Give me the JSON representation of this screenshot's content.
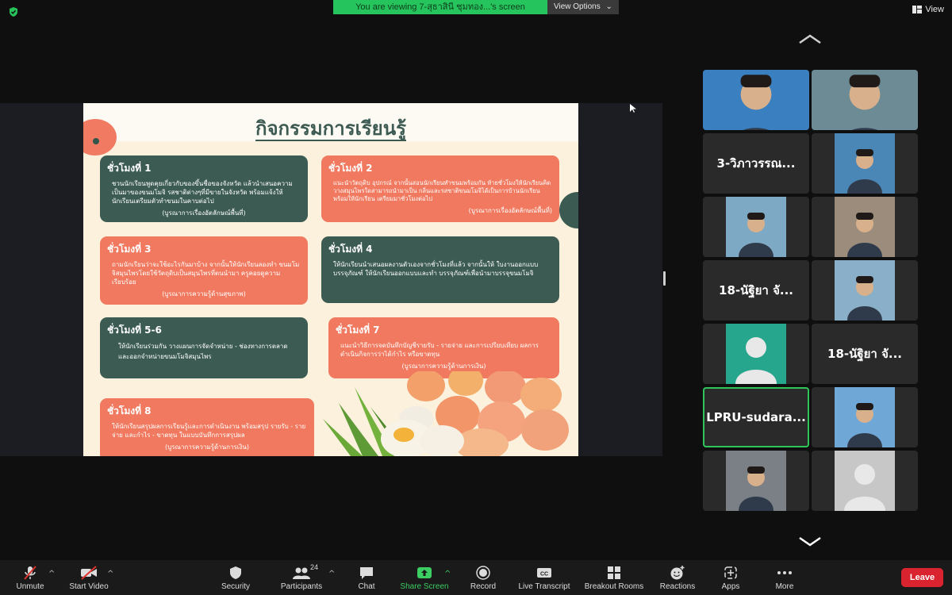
{
  "top_bar": {
    "viewing_banner": "You are viewing 7-สุธาสินี ชุมทอง...'s screen",
    "view_options": "View Options",
    "view_button": "View"
  },
  "slide": {
    "title": "กิจกรรมการเรียนรู้",
    "cards": [
      {
        "title": "ชั่วโมงที่ 1",
        "body": "ชวนนักเรียนพูดคุยเกี่ยวกับของขึ้นชื่อของจังหวัด แล้วนำเสนอความเป็นมาของขนมโมจิ รสชาติต่างๆที่มีขายในจังหวัด พร้อมแจ้งให้นักเรียนเตรียมตัวทำขนมในคาบต่อไป",
        "note": "(บูรณาการเรื่องอัตลักษณ์พื้นที่)",
        "color": "#3c5b53"
      },
      {
        "title": "ชั่วโมงที่ 2",
        "body": "แนะนำวัตถุดิบ อุปกรณ์ จากนั้นสอนนักเรียนทำขนมพร้อมกัน ท้ายชั่วโมงให้นักเรียนคิดวางสมุนไพรใดสามารถนำมาเป็น กลิ่นและรสชาติขนมโมจิได้เป็นการบ้านนักเรียนพร้อมให้นักเรียน เตรียมมาชั่วโมงต่อไป",
        "note": "(บูรณาการเรื่องอัตลักษณ์พื้นที่)",
        "color": "#f0795f"
      },
      {
        "title": "ชั่วโมงที่ 3",
        "body": "ถามนักเรียนว่าจะใช้อะไรกันมาบ้าง จากนั้นให้นักเรียนลองทำ ขนมโมจิสมุนไพรโดยใช้วัตถุดิบเป็นสมุนไพรที่ตนนำมา ครูคอยดูความเรียบร้อย",
        "note": "(บูรณาการความรู้ด้านสุขภาพ)",
        "color": "#f0795f"
      },
      {
        "title": "ชั่วโมงที่ 4",
        "body": "ให้นักเรียนนำเสนอผลงานตัวเองจากชั่วโมงที่แล้ว จากนั้นให้ ใบงานออกแบบบรรจุภัณฑ์ ให้นักเรียนออกแบบและทำ บรรจุภัณฑ์เพื่อนำมาบรรจุขนมโมจิ",
        "note": "",
        "color": "#3c5b53"
      },
      {
        "title": "ชั่วโมงที่ 5-6",
        "body": "ให้นักเรียนร่วมกัน วางแผนการจัดจำหน่าย - ช่องทางการตลาด และออกจำหน่ายขนมโมจิสมุนไพร",
        "note": "",
        "color": "#3c5b53"
      },
      {
        "title": "ชั่วโมงที่ 7",
        "body": "แนะนำวิธีการจดบันทึกบัญชีรายรับ - รายจ่าย และการเปรียบเทียบ ผลการดำเนินกิจการว่าได้กำไร หรือขาดทุน",
        "note": "(บูรณาการความรู้ด้านการเงิน)",
        "color": "#f0795f"
      },
      {
        "title": "ชั่วโมงที่ 8",
        "body": "ให้นักเรียนสรุปผลการเรียนรู้และการดำเนินงาน พร้อมสรุป รายรับ - รายจ่าย และกำไร - ขาดทุน ในแบบบันทึกการสรุปผล",
        "note": "(บูรณาการความรู้ด้านการเงิน)",
        "color": "#f0795f"
      }
    ]
  },
  "gallery": {
    "tiles": [
      {
        "type": "video",
        "name": "",
        "bg": "#3a7fc0"
      },
      {
        "type": "video",
        "name": "",
        "bg": "#6d8b94"
      },
      {
        "type": "name",
        "name": "3-วิภาวรรณ..."
      },
      {
        "type": "video",
        "name": "",
        "bg": "#4a86b6"
      },
      {
        "type": "video",
        "name": "",
        "bg": "#7ea9c4"
      },
      {
        "type": "video",
        "name": "",
        "bg": "#9c8c7c"
      },
      {
        "type": "name",
        "name": "18-นัฐิยา จั..."
      },
      {
        "type": "video",
        "name": "",
        "bg": "#8ab0c9"
      },
      {
        "type": "avatar",
        "name": "",
        "bg": "#27a68e"
      },
      {
        "type": "name",
        "name": "18-นัฐิยา จั..."
      },
      {
        "type": "name",
        "name": "LPRU-sudara...",
        "active": true
      },
      {
        "type": "video",
        "name": "",
        "bg": "#6fa7d6"
      },
      {
        "type": "video",
        "name": "",
        "bg": "#7b8087"
      },
      {
        "type": "avatar",
        "name": "",
        "bg": "#c7c7c7"
      }
    ]
  },
  "toolbar": {
    "unmute": "Unmute",
    "start_video": "Start Video",
    "security": "Security",
    "participants": "Participants",
    "participants_count": "24",
    "chat": "Chat",
    "share_screen": "Share Screen",
    "record": "Record",
    "live_transcript": "Live Transcript",
    "breakout_rooms": "Breakout Rooms",
    "reactions": "Reactions",
    "apps": "Apps",
    "more": "More",
    "leave": "Leave"
  },
  "colors": {
    "share_green": "#26c45c",
    "leave_red": "#d9232f",
    "slide_green": "#3c5b53",
    "slide_coral": "#f0795f"
  }
}
